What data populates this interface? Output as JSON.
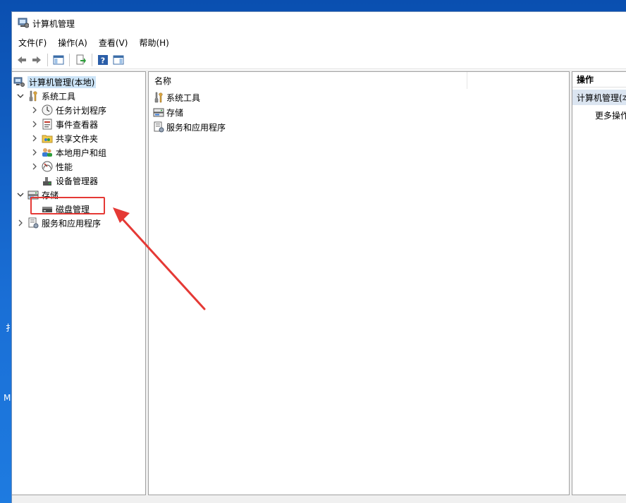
{
  "window": {
    "title": "计算机管理"
  },
  "menu": [
    "文件(F)",
    "操作(A)",
    "查看(V)",
    "帮助(H)"
  ],
  "tree": {
    "root": "计算机管理(本地)",
    "system_tools": {
      "label": "系统工具",
      "children": [
        "任务计划程序",
        "事件查看器",
        "共享文件夹",
        "本地用户和组",
        "性能",
        "设备管理器"
      ]
    },
    "storage": {
      "label": "存储",
      "children": [
        "磁盘管理"
      ]
    },
    "services": "服务和应用程序"
  },
  "list": {
    "header": "名称",
    "items": [
      "系统工具",
      "存储",
      "服务和应用程序"
    ]
  },
  "actions": {
    "header": "操作",
    "group": "计算机管理(本地)",
    "more": "更多操作"
  },
  "desktop_fragments": [
    "扌",
    "M"
  ],
  "colors": {
    "highlight": "#e53935",
    "selection": "#cce4f7",
    "desktop": "#1a6fd6"
  }
}
